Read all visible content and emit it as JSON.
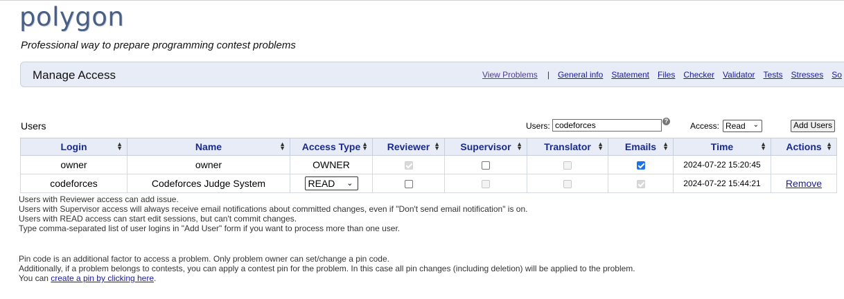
{
  "app": {
    "logo": "polygon",
    "tagline": "Professional way to prepare programming contest problems"
  },
  "header": {
    "title": "Manage Access",
    "nav_first": "View Problems",
    "separator": "|",
    "nav": [
      "General info",
      "Statement",
      "Files",
      "Checker",
      "Validator",
      "Tests",
      "Stresses",
      "So"
    ]
  },
  "users_section": {
    "label": "Users",
    "users_field_label": "Users:",
    "users_input_value": "codeforces",
    "access_label": "Access:",
    "access_selected": "Read",
    "add_button": "Add Users"
  },
  "table": {
    "columns": [
      "Login",
      "Name",
      "Access Type",
      "Reviewer",
      "Supervisor",
      "Translator",
      "Emails",
      "Time",
      "Actions"
    ],
    "rows": [
      {
        "login": "owner",
        "name": "owner",
        "access_type": "OWNER",
        "reviewer": {
          "checked": true,
          "disabled": true
        },
        "supervisor": {
          "checked": false,
          "disabled": false
        },
        "translator": {
          "checked": false,
          "disabled": true
        },
        "emails": {
          "checked": true,
          "disabled": false
        },
        "time": "2024-07-22 15:20:45",
        "action": ""
      },
      {
        "login": "codeforces",
        "name": "Codeforces Judge System",
        "access_type": "READ",
        "reviewer": {
          "checked": false,
          "disabled": false
        },
        "supervisor": {
          "checked": false,
          "disabled": true
        },
        "translator": {
          "checked": false,
          "disabled": true
        },
        "emails": {
          "checked": true,
          "disabled": true
        },
        "time": "2024-07-22 15:44:21",
        "action": "Remove"
      }
    ]
  },
  "notes": [
    "Users with Reviewer access can add issue.",
    "Users with Supervisor access will always receive email notifications about committed changes, even if \"Don't send email notification\" is on.",
    "Users with READ access can start edit sessions, but can't commit changes.",
    "Type comma-separated list of user logins in \"Add User\" form if you want to process more than one user."
  ],
  "pin": {
    "line1": "Pin code is an additional factor to access a problem. Only problem owner can set/change a pin code.",
    "line2": "Additionally, if a problem belongs to contests, you can apply a contest pin for the problem. In this case all pin changes (including deletion) will be applied to the problem.",
    "line3_prefix": "You can ",
    "line3_link": "create a pin by clicking here",
    "line3_suffix": "."
  },
  "icons": {
    "help": "help-icon",
    "sort": "sort-icon",
    "chevron": "chevron-down-icon"
  },
  "colors": {
    "header_bg": "#e7ecf6",
    "header_text": "#1a2a8c",
    "link": "#1a1a99",
    "logo": "#4a5f86",
    "checkbox_checked": "#1a73e8"
  }
}
